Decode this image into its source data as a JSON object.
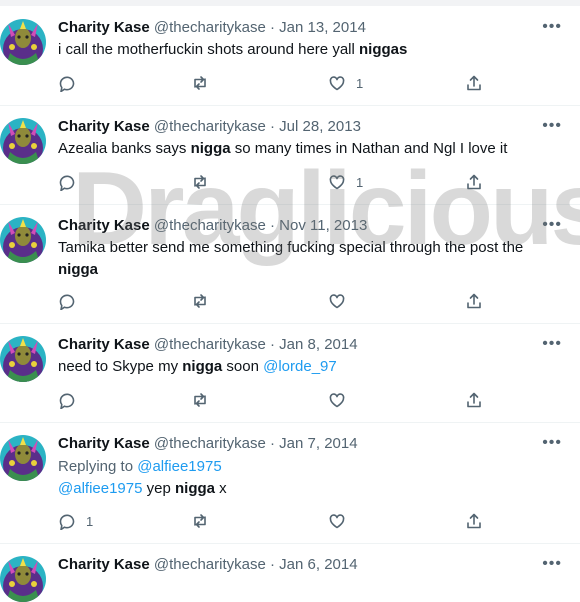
{
  "watermark": "Draglicious",
  "colors": {
    "link": "#1d9bf0",
    "muted": "#536471",
    "text": "#0f1419"
  },
  "user": {
    "name": "Charity Kase",
    "handle": "@thecharitykase"
  },
  "more_label": "•••",
  "icons": [
    "reply-icon",
    "retweet-icon",
    "like-icon",
    "share-icon",
    "more-icon"
  ],
  "tweets": [
    {
      "date": "· Jan 13, 2014",
      "text_before": "i call the motherfuckin shots around here yall ",
      "bold": "niggas",
      "text_after": "",
      "like_count": "1"
    },
    {
      "date": "· Jul 28, 2013",
      "text_before": "Azealia banks says ",
      "bold": "nigga",
      "text_after": " so many times in Nathan and Ngl I love it",
      "like_count": "1"
    },
    {
      "date": "· Nov 11, 2013",
      "text_before": "Tamika better send me something fucking special through the post the",
      "bold": "nigga",
      "text_after": ""
    },
    {
      "date": "· Jan 8, 2014",
      "text_before": "need to Skype my ",
      "bold": "nigga",
      "text_after": " soon ",
      "mention": "@lorde_97"
    },
    {
      "date": "· Jan 7, 2014",
      "replying_label": "Replying to ",
      "replying_to": "@alfiee1975",
      "mention": "@alfiee1975",
      "text_before": " yep ",
      "bold": "nigga",
      "text_after": " x",
      "reply_count": "1"
    },
    {
      "date": "· Jan 6, 2014"
    }
  ]
}
